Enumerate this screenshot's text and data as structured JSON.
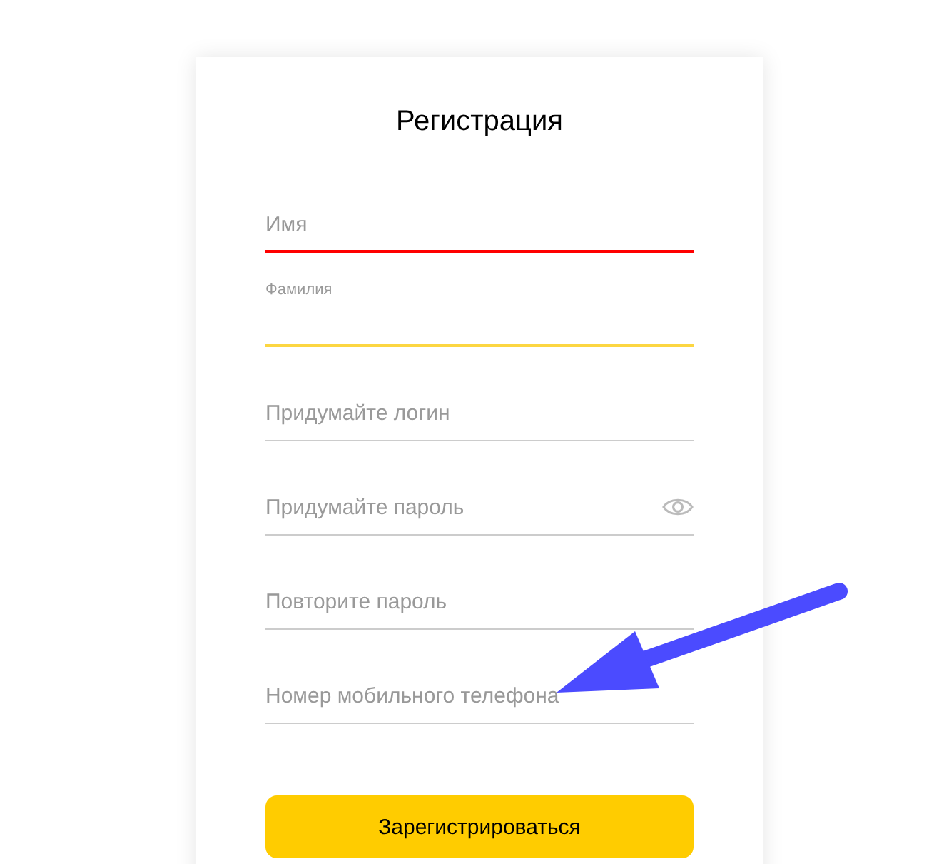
{
  "title": "Регистрация",
  "fields": [
    {
      "kind": "text",
      "placeholder": "Имя",
      "error": true,
      "focused": false
    },
    {
      "kind": "text",
      "placeholder": "Фамилия",
      "error": false,
      "focused": true
    },
    {
      "kind": "text",
      "placeholder": "Придумайте логин",
      "error": false,
      "focused": false
    },
    {
      "kind": "password",
      "placeholder": "Придумайте пароль",
      "error": false,
      "focused": false
    },
    {
      "kind": "text",
      "placeholder": "Повторите пароль",
      "error": false,
      "focused": false
    },
    {
      "kind": "text",
      "placeholder": "Номер мобильного телефона",
      "error": false,
      "focused": false
    }
  ],
  "submit": "Зарегистрироваться"
}
